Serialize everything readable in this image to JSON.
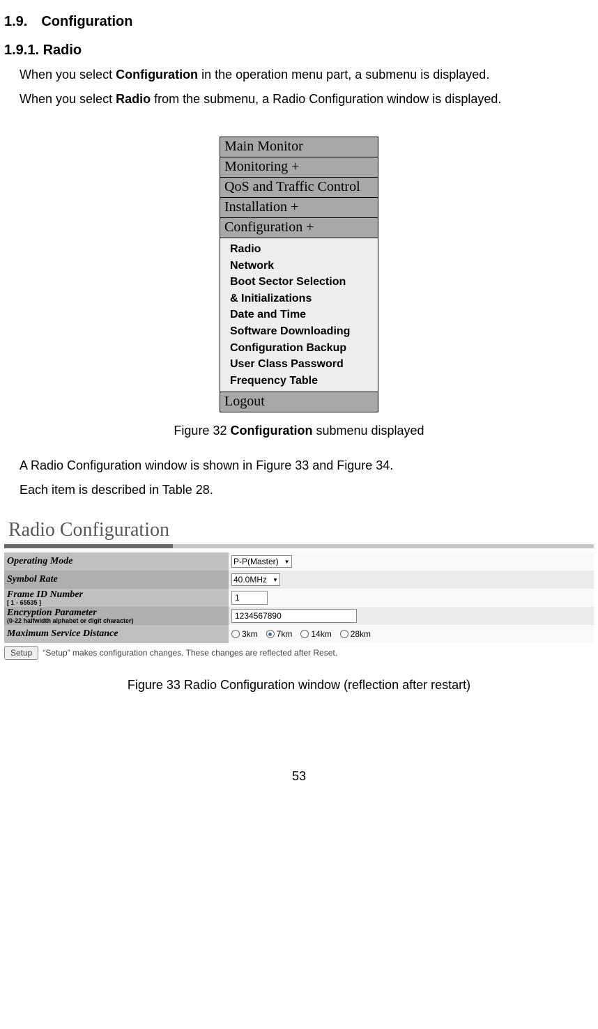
{
  "headings": {
    "h1": "1.9. Configuration",
    "h2": "1.9.1. Radio"
  },
  "para1_a": "When you select ",
  "para1_b": "Configuration",
  "para1_c": " in the operation menu part, a submenu is displayed.",
  "para2_a": "When you select ",
  "para2_b": "Radio",
  "para2_c": " from the submenu, a Radio Configuration window is displayed.",
  "menu": {
    "items": [
      "Main Monitor",
      "Monitoring +",
      "QoS and Traffic Control",
      "Installation +",
      "Configuration +"
    ],
    "submenu": [
      "Radio",
      "Network",
      "Boot Sector Selection",
      "& Initializations",
      "Date and Time",
      "Software Downloading",
      "Configuration Backup",
      "User Class Password",
      "Frequency Table"
    ],
    "logout": "Logout"
  },
  "caption32_a": "Figure 32 ",
  "caption32_b": "Configuration",
  "caption32_c": " submenu displayed",
  "mid1": "A Radio Configuration window is shown in Figure 33 and Figure 34.",
  "mid2": "Each item is described in Table 28.",
  "rc": {
    "title": "Radio Configuration",
    "rows": {
      "op_mode": {
        "label": "Operating Mode",
        "value": "P-P(Master)"
      },
      "sym_rate": {
        "label": "Symbol Rate",
        "value": "40.0MHz"
      },
      "frame_id": {
        "label": "Frame ID Number",
        "sub": "[ 1 - 65535 ]",
        "value": "1"
      },
      "enc": {
        "label": "Encryption Parameter",
        "sub": "(0-22 halfwidth alphabet or digit character)",
        "value": "1234567890"
      },
      "dist": {
        "label": "Maximum Service Distance",
        "opts": [
          "3km",
          "7km",
          "14km",
          "28km"
        ],
        "selected": 1
      }
    },
    "setup_btn": "Setup",
    "setup_note": "“Setup” makes configuration changes. These changes are reflected after Reset."
  },
  "caption33": "Figure 33 Radio Configuration window (reflection after restart)",
  "pagenum": "53"
}
